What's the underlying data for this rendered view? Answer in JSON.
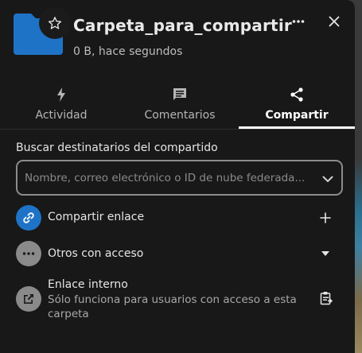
{
  "header": {
    "title": "Carpeta_para_compartir",
    "subtitle": "0 B, hace segundos",
    "folder_color": "#1e73c6"
  },
  "tabs": [
    {
      "label": "Actividad",
      "icon": "lightning-icon",
      "active": false
    },
    {
      "label": "Comentarios",
      "icon": "comment-icon",
      "active": false
    },
    {
      "label": "Compartir",
      "icon": "share-icon",
      "active": true
    }
  ],
  "share": {
    "search_label": "Buscar destinatarios del compartido",
    "search_placeholder": "Nombre, correo electrónico o ID de nube federada...",
    "search_value": "",
    "share_link_label": "Compartir enlace",
    "others_label": "Otros con acceso",
    "internal_link_label": "Enlace interno",
    "internal_link_desc": "Sólo funciona para usuarios con acceso a esta carpeta"
  },
  "colors": {
    "accent": "#1e73c6",
    "panel_bg": "#181818"
  }
}
